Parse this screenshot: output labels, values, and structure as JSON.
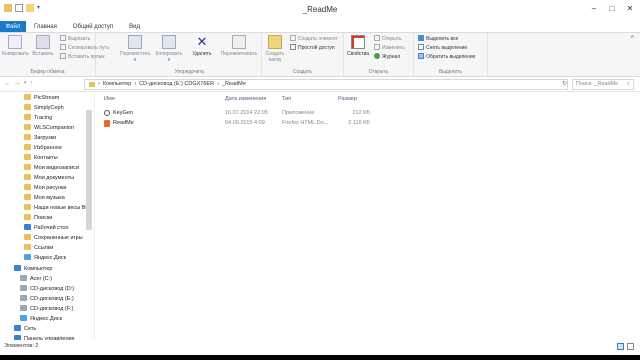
{
  "window": {
    "title": "_ReadMe"
  },
  "tabs": [
    "Файл",
    "Главная",
    "Общий доступ",
    "Вид"
  ],
  "ribbon": {
    "clipboard": {
      "copy": "Копировать",
      "paste": "Вставить",
      "cut": "Вырезать",
      "copy_path": "Скопировать путь",
      "paste_shortcut": "Вставить ярлык",
      "label": "Буфер обмена"
    },
    "organize": {
      "move_to": "Переместить в",
      "copy_to": "Копировать в",
      "delete": "Удалить",
      "rename": "Переименовать",
      "label": "Упорядочить"
    },
    "new": {
      "new_folder": "Создать папку",
      "new_item": "Создать элемент",
      "easy_access": "Простой доступ",
      "label": "Создать"
    },
    "open": {
      "properties": "Свойства",
      "open": "Открыть",
      "edit": "Изменить",
      "history": "Журнал",
      "label": "Открыть"
    },
    "select": {
      "select_all": "Выделить все",
      "select_none": "Снять выделение",
      "invert": "Обратить выделение",
      "label": "Выделить"
    }
  },
  "address": {
    "crumbs": [
      "Компьютер",
      "CD-дисковод (E:) CDGX76ER",
      "_ReadMe"
    ],
    "search_placeholder": "Поиск: _ReadMe"
  },
  "nav": [
    {
      "label": "PicStream",
      "color": "#e8c25a"
    },
    {
      "label": "SimplyCeph",
      "color": "#e8c25a"
    },
    {
      "label": "Tracing",
      "color": "#e8c25a"
    },
    {
      "label": "WLSCompanion",
      "color": "#e8c25a"
    },
    {
      "label": "Загрузки",
      "color": "#e8c25a"
    },
    {
      "label": "Избранное",
      "color": "#e8c25a"
    },
    {
      "label": "Контакты",
      "color": "#e8c25a"
    },
    {
      "label": "Мои видеозаписи",
      "color": "#e8c25a"
    },
    {
      "label": "Мои документы",
      "color": "#e8c25a"
    },
    {
      "label": "Мои рисунки",
      "color": "#e8c25a"
    },
    {
      "label": "Моя музыка",
      "color": "#e8c25a"
    },
    {
      "label": "Наши новые весы BE",
      "color": "#e8c25a"
    },
    {
      "label": "Поиски",
      "color": "#e8c25a"
    },
    {
      "label": "Рабочий стол",
      "color": "#3a7fd5"
    },
    {
      "label": "Сохраненные игры",
      "color": "#e8c25a"
    },
    {
      "label": "Ссылки",
      "color": "#e8c25a"
    },
    {
      "label": "Яндекс.Диск",
      "color": "#4aa3df"
    },
    {
      "label": "Компьютер",
      "color": "#3a7fd5"
    },
    {
      "label": "Acer (C:)",
      "color": "#9aa8b5"
    },
    {
      "label": "CD-дисковод (D:)",
      "color": "#9aa8b5"
    },
    {
      "label": "CD-дисковод (E:)",
      "color": "#9aa8b5"
    },
    {
      "label": "CD-дисковод (F:)",
      "color": "#9aa8b5"
    },
    {
      "label": "Яндекс.Диск",
      "color": "#4aa3df"
    },
    {
      "label": "Сеть",
      "color": "#3a7fd5"
    },
    {
      "label": "Панель управления",
      "color": "#3a7fd5"
    }
  ],
  "columns": {
    "name": "Имя",
    "date": "Дата изменения",
    "type": "Тип",
    "size": "Размер"
  },
  "files": [
    {
      "name": "KeyGen",
      "date": "16.07.2014 22:05",
      "type": "Приложение",
      "size": "212 КБ",
      "icon": "keygen-icon"
    },
    {
      "name": "ReadMe",
      "date": "04.09.2015 4:09",
      "type": "Firefox HTML Do...",
      "size": "2 116 КБ",
      "icon": "html-file-icon"
    }
  ],
  "status": {
    "count": "Элементов: 2"
  }
}
